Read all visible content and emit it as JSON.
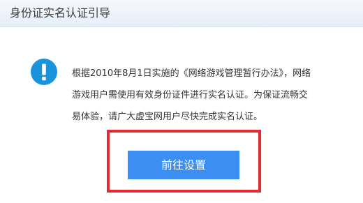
{
  "header": {
    "title": "身份证实名认证引导"
  },
  "notice": {
    "icon": "exclamation-circle-icon",
    "icon_color": "#1a93dd",
    "lines": [
      "根据2010年8月1日实施的《网络游戏管理暂行办法》，网络",
      "游戏用户需使用有效身份证件进行实名认证。为保证流畅交",
      "易体验，请广大虚宝网用户尽快完成实名认证。"
    ]
  },
  "actions": {
    "goto_label": "前往设置",
    "button_color": "#3d8ef3",
    "highlight_color": "#e8292d"
  }
}
